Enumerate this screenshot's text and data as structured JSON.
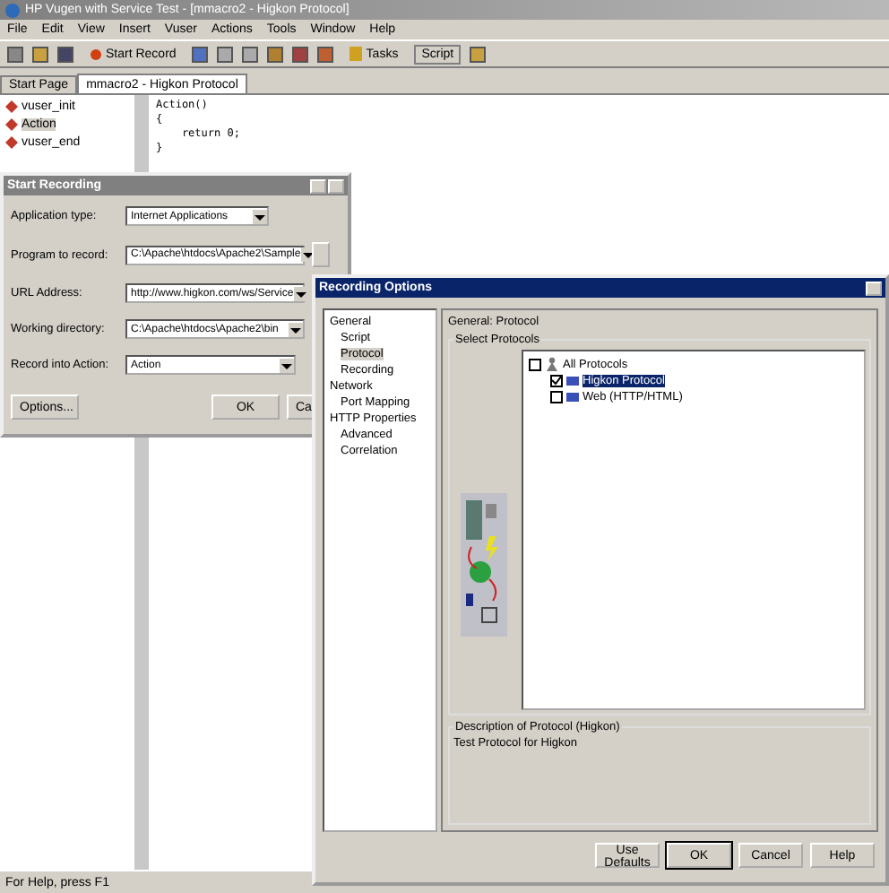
{
  "window": {
    "title": "HP Vugen with Service Test - [mmacro2 - Higkon Protocol]"
  },
  "menu": [
    "File",
    "Edit",
    "View",
    "Insert",
    "Vuser",
    "Actions",
    "Tools",
    "Window",
    "Help"
  ],
  "toolbar": {
    "start_record": "Start Record",
    "tasks": "Tasks",
    "script": "Script"
  },
  "tabs": [
    {
      "label": "Start Page",
      "selected": false
    },
    {
      "label": "mmacro2 - Higkon Protocol",
      "selected": true
    }
  ],
  "script_tree": [
    {
      "label": "vuser_init",
      "selected": false
    },
    {
      "label": "Action",
      "selected": true
    },
    {
      "label": "vuser_end",
      "selected": false
    }
  ],
  "code": [
    "Action()",
    "{",
    "    return 0;",
    "}"
  ],
  "start_recording": {
    "title": "Start Recording",
    "fields": [
      {
        "label": "Application type:",
        "value": "Internet Applications"
      },
      {
        "label": "Program to record:",
        "value": "C:\\Apache\\htdocs\\Apache2\\Sample"
      },
      {
        "label": "URL Address:",
        "value": "http://www.higkon.com/ws/Service"
      },
      {
        "label": "Working directory:",
        "value": "C:\\Apache\\htdocs\\Apache2\\bin"
      },
      {
        "label": "Record into Action:",
        "value": "Action"
      }
    ],
    "buttons": [
      "Options...",
      "OK",
      "Ca"
    ]
  },
  "recording_options": {
    "title": "Recording Options",
    "nav": [
      {
        "label": "General",
        "selected": false,
        "children": [
          {
            "label": "Script",
            "selected": false
          },
          {
            "label": "Protocol",
            "selected": true
          },
          {
            "label": "Recording",
            "selected": false
          }
        ]
      },
      {
        "label": "Network",
        "selected": false,
        "children": [
          {
            "label": "Port Mapping",
            "selected": false
          }
        ]
      },
      {
        "label": "HTTP Properties",
        "selected": false,
        "children": [
          {
            "label": "Advanced",
            "selected": false
          },
          {
            "label": "Correlation",
            "selected": false
          }
        ]
      }
    ],
    "heading": "General: Protocol",
    "group": "Select Protocols",
    "protocols": {
      "label": "All Protocols",
      "checked": false,
      "children": [
        {
          "label": "Higkon Protocol",
          "checked": true,
          "selected": true
        },
        {
          "label": "Web (HTTP/HTML)",
          "checked": false,
          "selected": false
        }
      ]
    },
    "description_title": "Description of Protocol (Higkon)",
    "description": "Test Protocol for Higkon",
    "buttons": [
      "Use Defaults",
      "OK",
      "Cancel",
      "Help"
    ]
  },
  "status_bar": "For Help, press F1"
}
